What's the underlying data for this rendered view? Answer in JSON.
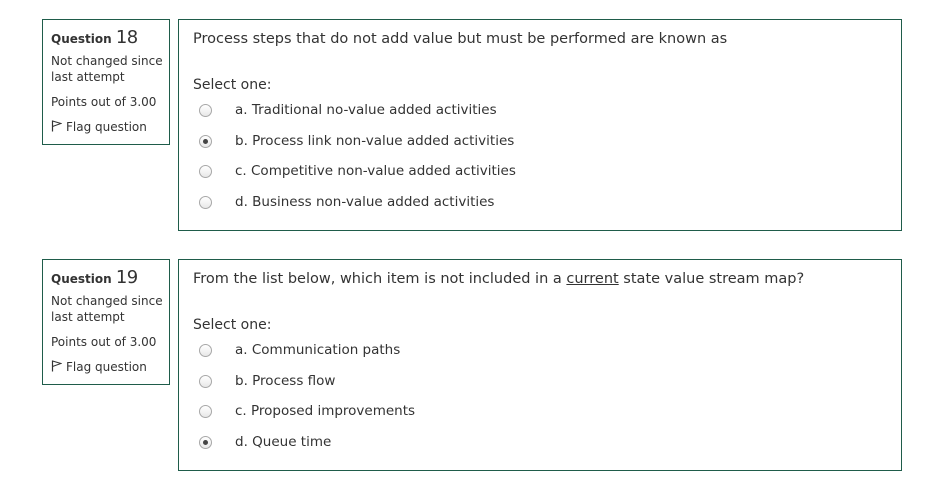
{
  "questions": [
    {
      "label": "Question",
      "number": "18",
      "state": "Not changed since last attempt",
      "grade": "Points out of 3.00",
      "flag_label": "Flag question",
      "text_before": "Process steps that do not add value but must be performed are known as",
      "text_underlined": "",
      "text_after": "",
      "prompt": "Select one:",
      "options": [
        {
          "label": "a. Traditional no-value added activities",
          "checked": false
        },
        {
          "label": "b. Process link non-value added activities",
          "checked": true
        },
        {
          "label": "c. Competitive non-value added activities",
          "checked": false
        },
        {
          "label": "d. Business non-value added activities",
          "checked": false
        }
      ]
    },
    {
      "label": "Question",
      "number": "19",
      "state": "Not changed since last attempt",
      "grade": "Points out of 3.00",
      "flag_label": "Flag question",
      "text_before": "From the list below, which item is not included in a ",
      "text_underlined": "current",
      "text_after": " state value stream map?",
      "prompt": "Select one:",
      "options": [
        {
          "label": "a. Communication paths",
          "checked": false
        },
        {
          "label": "b. Process flow",
          "checked": false
        },
        {
          "label": "c. Proposed improvements",
          "checked": false
        },
        {
          "label": "d. Queue time",
          "checked": true
        }
      ]
    }
  ]
}
